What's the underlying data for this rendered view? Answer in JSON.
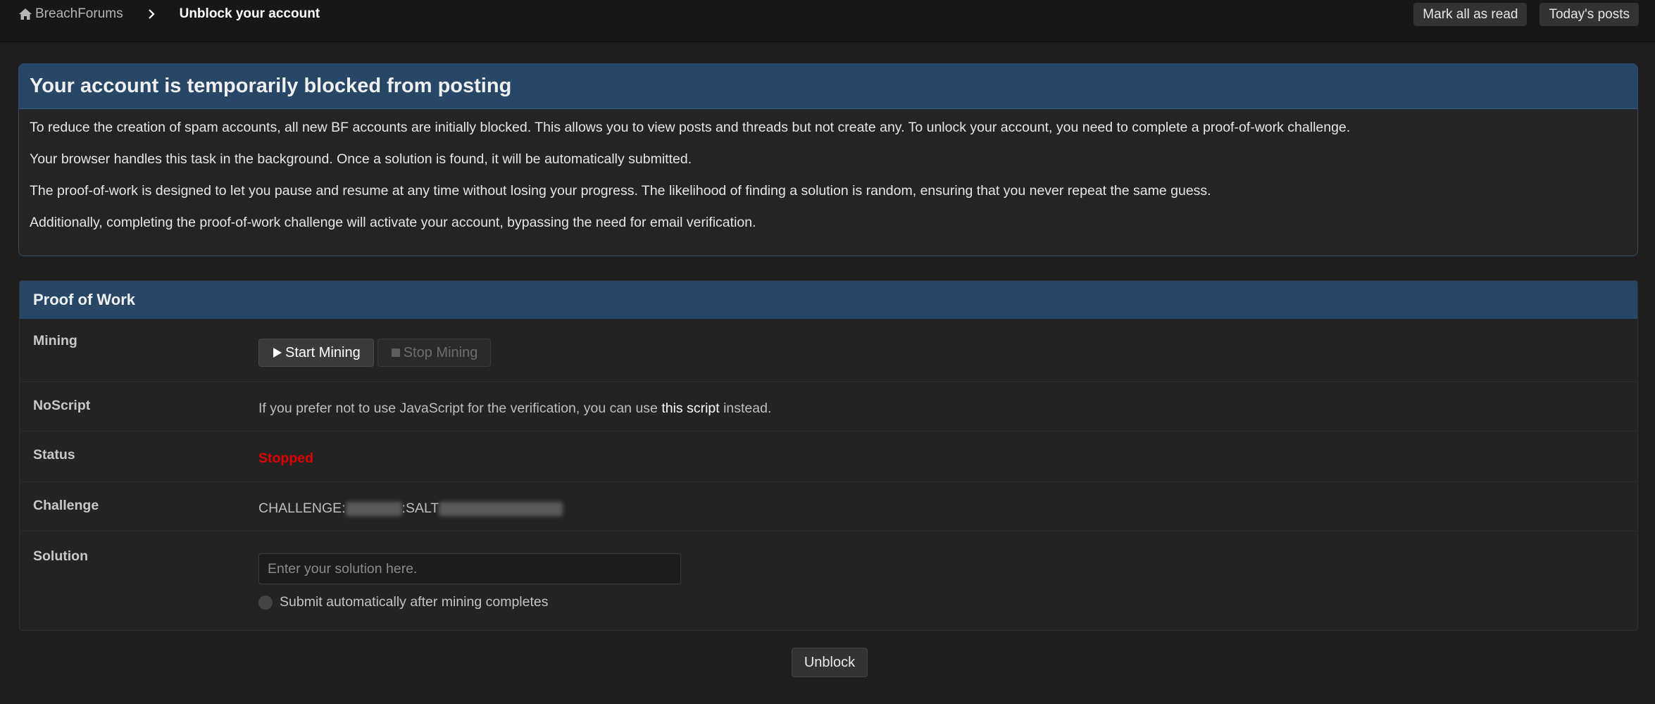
{
  "breadcrumb": {
    "home_label": "BreachForums",
    "current": "Unblock your account"
  },
  "top_actions": {
    "mark_read": "Mark all as read",
    "todays_posts": "Today's posts"
  },
  "info": {
    "title": "Your account is temporarily blocked from posting",
    "paragraphs": [
      "To reduce the creation of spam accounts, all new BF accounts are initially blocked. This allows you to view posts and threads but not create any. To unlock your account, you need to complete a proof-of-work challenge.",
      "Your browser handles this task in the background. Once a solution is found, it will be automatically submitted.",
      "The proof-of-work is designed to let you pause and resume at any time without losing your progress. The likelihood of finding a solution is random, ensuring that you never repeat the same guess.",
      "Additionally, completing the proof-of-work challenge will activate your account, bypassing the need for email verification."
    ]
  },
  "pow": {
    "title": "Proof of Work",
    "mining": {
      "label": "Mining",
      "start": "Start Mining",
      "stop": "Stop Mining"
    },
    "noscript": {
      "label": "NoScript",
      "text_before": "If you prefer not to use JavaScript for the verification, you can use ",
      "link": "this script",
      "text_after": " instead."
    },
    "status": {
      "label": "Status",
      "value": "Stopped",
      "color": "#e00000"
    },
    "challenge": {
      "label": "Challenge",
      "prefix": "CHALLENGE:",
      "middle": ":SALT"
    },
    "solution": {
      "label": "Solution",
      "placeholder": "Enter your solution here.",
      "value": "",
      "auto_submit": "Submit automatically after mining completes",
      "auto_submit_checked": false
    }
  },
  "unblock_label": "Unblock",
  "colors": {
    "header_blue": "#284766",
    "page_bg": "#1e1e1e",
    "status_red": "#e00000"
  },
  "icons": {
    "home": "home-icon",
    "chevron": "chevron-right-icon",
    "play": "play-icon",
    "stop": "stop-icon"
  }
}
